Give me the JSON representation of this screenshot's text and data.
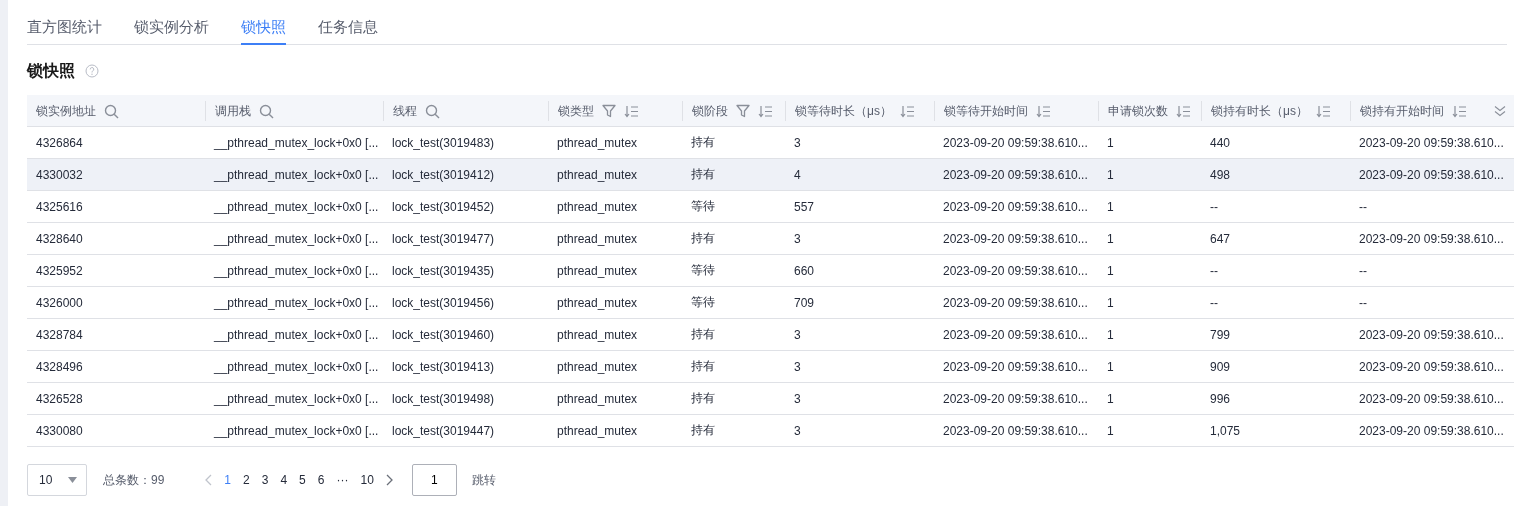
{
  "tabs": [
    {
      "label": "直方图统计",
      "selected": false
    },
    {
      "label": "锁实例分析",
      "selected": false
    },
    {
      "label": "锁快照",
      "selected": true
    },
    {
      "label": "任务信息",
      "selected": false
    }
  ],
  "section": {
    "title": "锁快照"
  },
  "table": {
    "columns": [
      {
        "label": "锁实例地址",
        "kind": "search"
      },
      {
        "label": "调用栈",
        "kind": "search"
      },
      {
        "label": "线程",
        "kind": "search"
      },
      {
        "label": "锁类型",
        "kind": "filter_sort"
      },
      {
        "label": "锁阶段",
        "kind": "filter_sort"
      },
      {
        "label": "锁等待时长（μs）",
        "kind": "sort"
      },
      {
        "label": "锁等待开始时间",
        "kind": "sort"
      },
      {
        "label": "申请锁次数",
        "kind": "sort"
      },
      {
        "label": "锁持有时长（μs）",
        "kind": "sort"
      },
      {
        "label": "锁持有开始时间",
        "kind": "sort"
      }
    ],
    "rows": [
      {
        "selected": false,
        "cells": [
          "4326864",
          "__pthread_mutex_lock+0x0 [...",
          "lock_test(3019483)",
          "pthread_mutex",
          "持有",
          "3",
          "2023-09-20 09:59:38.610...",
          "1",
          "440",
          "2023-09-20 09:59:38.610..."
        ]
      },
      {
        "selected": true,
        "cells": [
          "4330032",
          "__pthread_mutex_lock+0x0 [...",
          "lock_test(3019412)",
          "pthread_mutex",
          "持有",
          "4",
          "2023-09-20 09:59:38.610...",
          "1",
          "498",
          "2023-09-20 09:59:38.610..."
        ]
      },
      {
        "selected": false,
        "cells": [
          "4325616",
          "__pthread_mutex_lock+0x0 [...",
          "lock_test(3019452)",
          "pthread_mutex",
          "等待",
          "557",
          "2023-09-20 09:59:38.610...",
          "1",
          "--",
          "--"
        ]
      },
      {
        "selected": false,
        "cells": [
          "4328640",
          "__pthread_mutex_lock+0x0 [...",
          "lock_test(3019477)",
          "pthread_mutex",
          "持有",
          "3",
          "2023-09-20 09:59:38.610...",
          "1",
          "647",
          "2023-09-20 09:59:38.610..."
        ]
      },
      {
        "selected": false,
        "cells": [
          "4325952",
          "__pthread_mutex_lock+0x0 [...",
          "lock_test(3019435)",
          "pthread_mutex",
          "等待",
          "660",
          "2023-09-20 09:59:38.610...",
          "1",
          "--",
          "--"
        ]
      },
      {
        "selected": false,
        "cells": [
          "4326000",
          "__pthread_mutex_lock+0x0 [...",
          "lock_test(3019456)",
          "pthread_mutex",
          "等待",
          "709",
          "2023-09-20 09:59:38.610...",
          "1",
          "--",
          "--"
        ]
      },
      {
        "selected": false,
        "cells": [
          "4328784",
          "__pthread_mutex_lock+0x0 [...",
          "lock_test(3019460)",
          "pthread_mutex",
          "持有",
          "3",
          "2023-09-20 09:59:38.610...",
          "1",
          "799",
          "2023-09-20 09:59:38.610..."
        ]
      },
      {
        "selected": false,
        "cells": [
          "4328496",
          "__pthread_mutex_lock+0x0 [...",
          "lock_test(3019413)",
          "pthread_mutex",
          "持有",
          "3",
          "2023-09-20 09:59:38.610...",
          "1",
          "909",
          "2023-09-20 09:59:38.610..."
        ]
      },
      {
        "selected": false,
        "cells": [
          "4326528",
          "__pthread_mutex_lock+0x0 [...",
          "lock_test(3019498)",
          "pthread_mutex",
          "持有",
          "3",
          "2023-09-20 09:59:38.610...",
          "1",
          "996",
          "2023-09-20 09:59:38.610..."
        ]
      },
      {
        "selected": false,
        "cells": [
          "4330080",
          "__pthread_mutex_lock+0x0 [...",
          "lock_test(3019447)",
          "pthread_mutex",
          "持有",
          "3",
          "2023-09-20 09:59:38.610...",
          "1",
          "1,075",
          "2023-09-20 09:59:38.610..."
        ]
      }
    ]
  },
  "pagination": {
    "page_size": "10",
    "total": "总条数：99",
    "pages": [
      {
        "label": "1",
        "selected": true
      },
      {
        "label": "2",
        "selected": false
      },
      {
        "label": "3",
        "selected": false
      },
      {
        "label": "4",
        "selected": false
      },
      {
        "label": "5",
        "selected": false
      },
      {
        "label": "6",
        "selected": false
      },
      {
        "label": "···",
        "selected": false
      },
      {
        "label": "10",
        "selected": false
      }
    ],
    "jump_value": "1",
    "jump_label": "跳转"
  }
}
